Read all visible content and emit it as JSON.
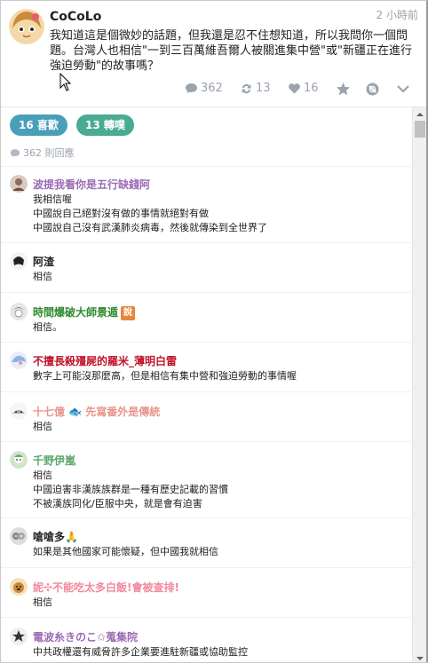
{
  "post": {
    "author": "CoCoLo",
    "time": "2 小時前",
    "body": "我知道這是個微妙的話題，但我還是忍不住想知道，所以我問你一個問題。台灣人也相信\"一到三百萬維吾爾人被關進集中營\"或\"新疆正在進行強迫勞動\"的故事嗎？",
    "stats": {
      "comments": "362",
      "reposts": "13",
      "likes": "16"
    }
  },
  "badges": {
    "likes": "16 喜歡",
    "reposts": "13 轉噗"
  },
  "reply_count": "362 則回應",
  "colors": {
    "like_badge": "#4a9fb8",
    "repost_badge": "#4aab93",
    "stat_icon": "#9aa3ae"
  },
  "comments": [
    {
      "name": "波提我看你是五行缺錢阿",
      "color": "#9b6bb3",
      "lines": [
        "我相信喔",
        "中國說自己絕對沒有做的事情就絕對有做",
        "中國說自己沒有武漢肺炎病毒，然後就傳染到全世界了"
      ]
    },
    {
      "name": "阿渣",
      "color": "#222222",
      "lines": [
        "相信"
      ]
    },
    {
      "name": "時間爆破大師景遁",
      "color": "#2e8b2e",
      "role": "說",
      "lines": [
        "相信。"
      ]
    },
    {
      "name": "不擅長殺殭屍的羅米_薄明白雷",
      "color": "#c0132a",
      "lines": [
        "數字上可能沒那麼高，但是相信有集中營和強迫勞動的事情喔"
      ]
    },
    {
      "name": "十七億 🐟 先寫番外是傳統",
      "color": "#e8958c",
      "lines": [
        "相信"
      ]
    },
    {
      "name": "千野伊嵐",
      "color": "#5aa86a",
      "lines": [
        "相信",
        "中國迫害非漢族族群是一種有歷史記載的習慣",
        "不被漢族同化/臣服中央，就是會有迫害"
      ]
    },
    {
      "name": "嗆嗆多🙏",
      "color": "#222222",
      "lines": [
        "如果是其他國家可能懷疑，但中國我就相信"
      ]
    },
    {
      "name": "妮✣不能吃太多白飯!會被查排!",
      "color": "#f08a9c",
      "lines": [
        "相信"
      ]
    },
    {
      "name": "電波糸きのこ✩蒐集院",
      "color": "#9b6bb3",
      "lines": [
        "中共政權還有威脅許多企業要進駐新疆或協助監控"
      ]
    }
  ]
}
